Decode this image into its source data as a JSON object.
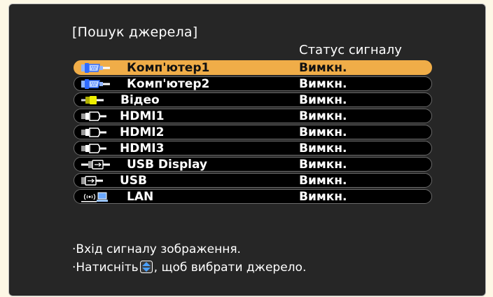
{
  "title": "[Пошук джерела]",
  "status_header": "Статус сигналу",
  "sources": [
    {
      "name": "Комп'ютер1",
      "icon": "vga-computer-icon",
      "status": "Вимкн.",
      "selected": true
    },
    {
      "name": "Комп'ютер2",
      "icon": "vga-computer-icon",
      "status": "Вимкн.",
      "selected": false
    },
    {
      "name": "Відео",
      "icon": "rca-video-icon",
      "status": "Вимкн.",
      "selected": false
    },
    {
      "name": "HDMI1",
      "icon": "hdmi-icon",
      "status": "Вимкн.",
      "selected": false
    },
    {
      "name": "HDMI2",
      "icon": "hdmi-icon",
      "status": "Вимкн.",
      "selected": false
    },
    {
      "name": "HDMI3",
      "icon": "hdmi-icon",
      "status": "Вимкн.",
      "selected": false
    },
    {
      "name": "USB Display",
      "icon": "usb-display-icon",
      "status": "Вимкн.",
      "selected": false
    },
    {
      "name": "USB",
      "icon": "usb-icon",
      "status": "Вимкн.",
      "selected": false
    },
    {
      "name": "LAN",
      "icon": "lan-wireless-icon",
      "status": "Вимкн.",
      "selected": false
    }
  ],
  "help": {
    "line1": "·Вхід сигналу зображення.",
    "line2_prefix": "·Натисніть",
    "line2_suffix": ", щоб вибрати джерело."
  },
  "colors": {
    "background": "#262626",
    "selected_row": "#f0ad48",
    "row": "#000000",
    "text": "#ffffff",
    "outer": "#fdf8e6"
  }
}
